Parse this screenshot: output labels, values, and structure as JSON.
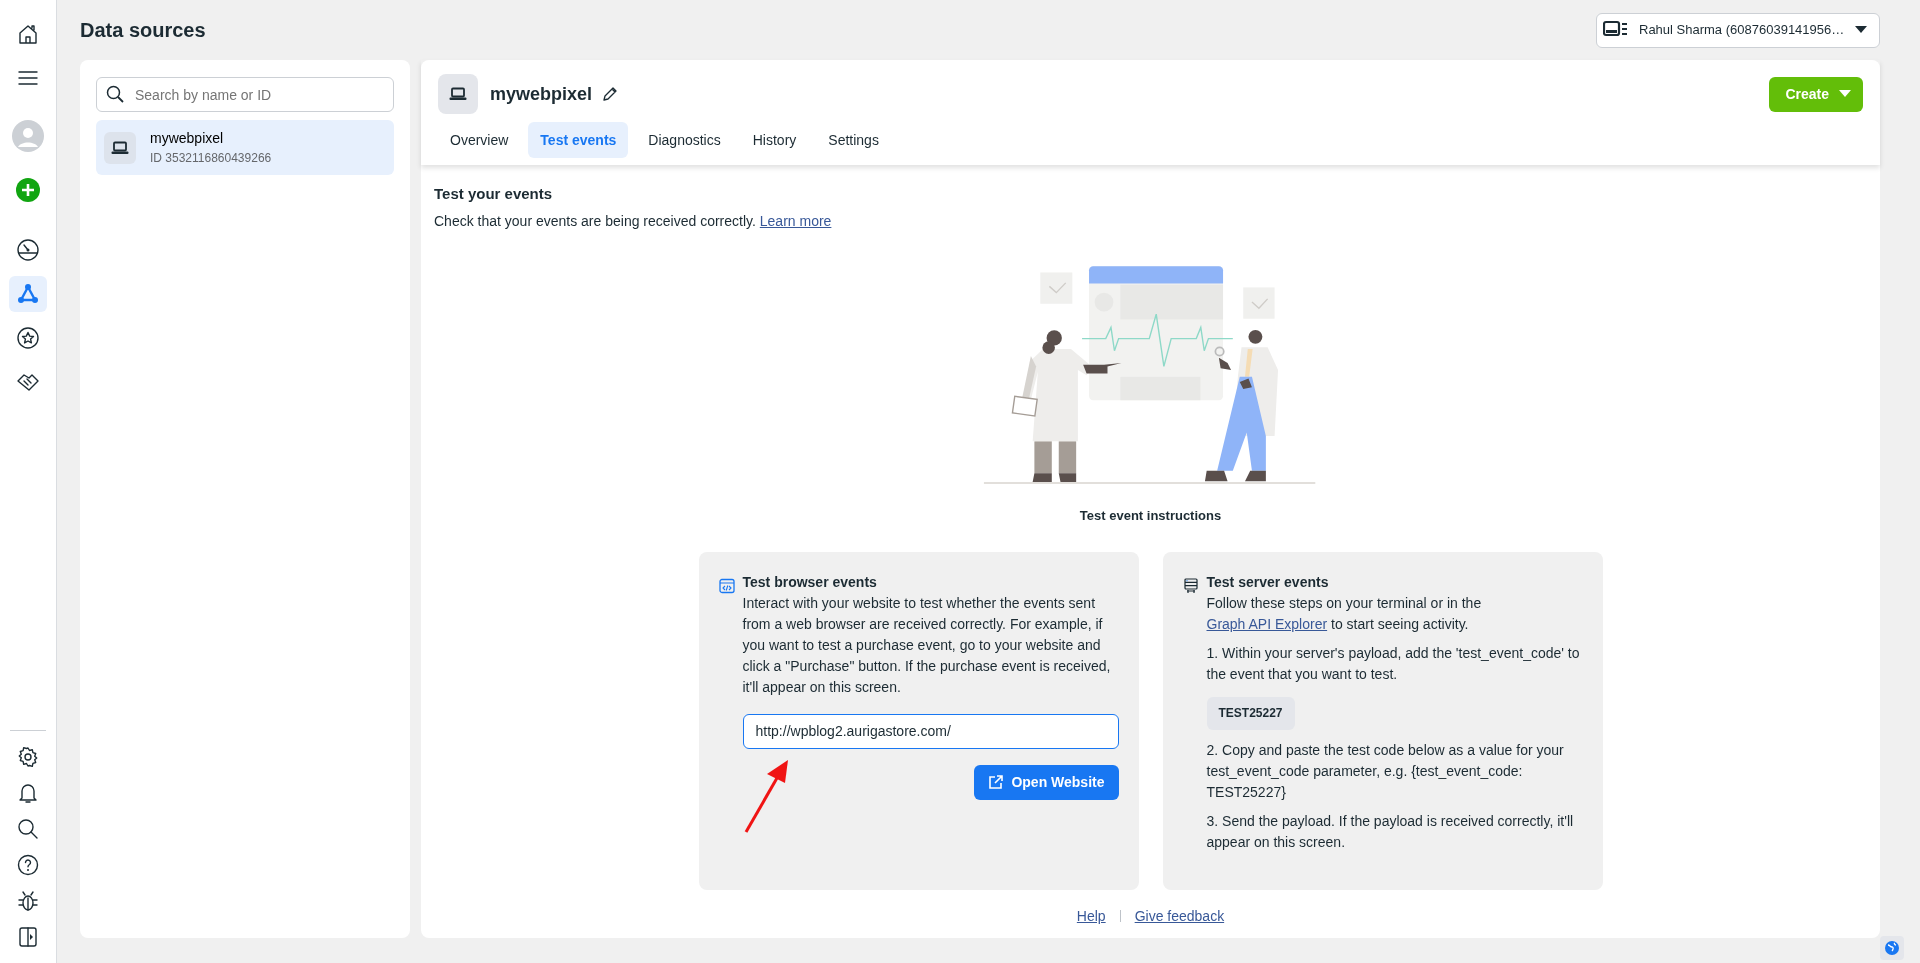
{
  "rail": {
    "top": [
      {
        "kind": "home",
        "selected": false
      },
      {
        "kind": "menu",
        "selected": false
      },
      {
        "kind": "avatar",
        "selected": false
      },
      {
        "kind": "create",
        "selected": false
      },
      {
        "kind": "gauge",
        "selected": false
      },
      {
        "kind": "network",
        "selected": true
      },
      {
        "kind": "star",
        "selected": false
      },
      {
        "kind": "handshake",
        "selected": false
      }
    ],
    "bottom": [
      {
        "kind": "settings",
        "selected": false
      },
      {
        "kind": "bell",
        "selected": false
      },
      {
        "kind": "search",
        "selected": false
      },
      {
        "kind": "help",
        "selected": false
      },
      {
        "kind": "bug",
        "selected": false
      },
      {
        "kind": "panel",
        "selected": false
      }
    ]
  },
  "page_title": "Data sources",
  "account": {
    "name": "Rahul Sharma (60876039141956…"
  },
  "sources": {
    "search_placeholder": "Search by name or ID",
    "items": [
      {
        "name": "mywebpixel",
        "id": "ID 3532116860439266",
        "selected": true
      }
    ]
  },
  "pixel": {
    "name": "mywebpixel",
    "create_button": "Create"
  },
  "tabs": [
    {
      "label": "Overview",
      "selected": false
    },
    {
      "label": "Test events",
      "selected": true
    },
    {
      "label": "Diagnostics",
      "selected": false
    },
    {
      "label": "History",
      "selected": false
    },
    {
      "label": "Settings",
      "selected": false
    }
  ],
  "section": {
    "title": "Test your events",
    "description": "Check that your events are being received correctly.",
    "link": "Learn more",
    "caption": "Test event instructions"
  },
  "browser_card": {
    "title": "Test browser events",
    "body": "Interact with your website to test whether the events sent from a web browser are received correctly. For example, if you want to test a purchase event, go to your website and click a \"Purchase\" button. If the purchase event is received, it'll appear on this screen.",
    "url": "http://wpblog2.aurigastore.com/",
    "button": "Open Website"
  },
  "server_card": {
    "title": "Test server events",
    "intro_before": "Follow these steps on your terminal or in the",
    "intro_link": "Graph API Explorer",
    "intro_after": "to start seeing activity.",
    "steps": [
      {
        "kind": "text",
        "text": "1. Within your server's payload, add the 'test_event_code' to the event that you want to test."
      },
      {
        "kind": "code",
        "text": "TEST25227"
      },
      {
        "kind": "text",
        "text": "2. Copy and paste the test code below as a value for your test_event_code parameter, e.g. {test_event_code: TEST25227}"
      },
      {
        "kind": "text",
        "text": "3. Send the payload. If the payload is received correctly, it'll appear on this screen."
      }
    ]
  },
  "footer": {
    "links": [
      "Help",
      "Give feedback"
    ]
  }
}
